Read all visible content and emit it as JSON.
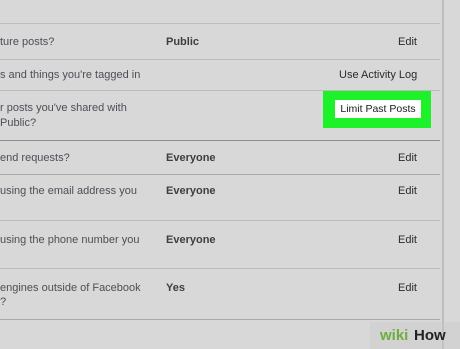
{
  "rows": [
    {
      "q": "ture posts?",
      "value": "Public",
      "action": "Edit"
    },
    {
      "q": "s and things you're tagged in",
      "value": "",
      "action": "Use Activity Log"
    },
    {
      "q1": "r posts you've shared with",
      "q2": "Public?",
      "action": "Limit Past Posts"
    },
    {
      "q": "end requests?",
      "value": "Everyone",
      "action": "Edit"
    },
    {
      "q1": " using the email address you",
      "q2": "",
      "value": "Everyone",
      "action": "Edit"
    },
    {
      "q1": " using the phone number you",
      "q2": "",
      "value": "Everyone",
      "action": "Edit"
    },
    {
      "q1": "engines outside of Facebook",
      "q2": "?",
      "value": "Yes",
      "action": "Edit"
    }
  ],
  "watermark": {
    "wiki": "wiki",
    "how": "How"
  },
  "colors": {
    "highlight": "#1cf12a",
    "background": "#d8d8d8"
  }
}
